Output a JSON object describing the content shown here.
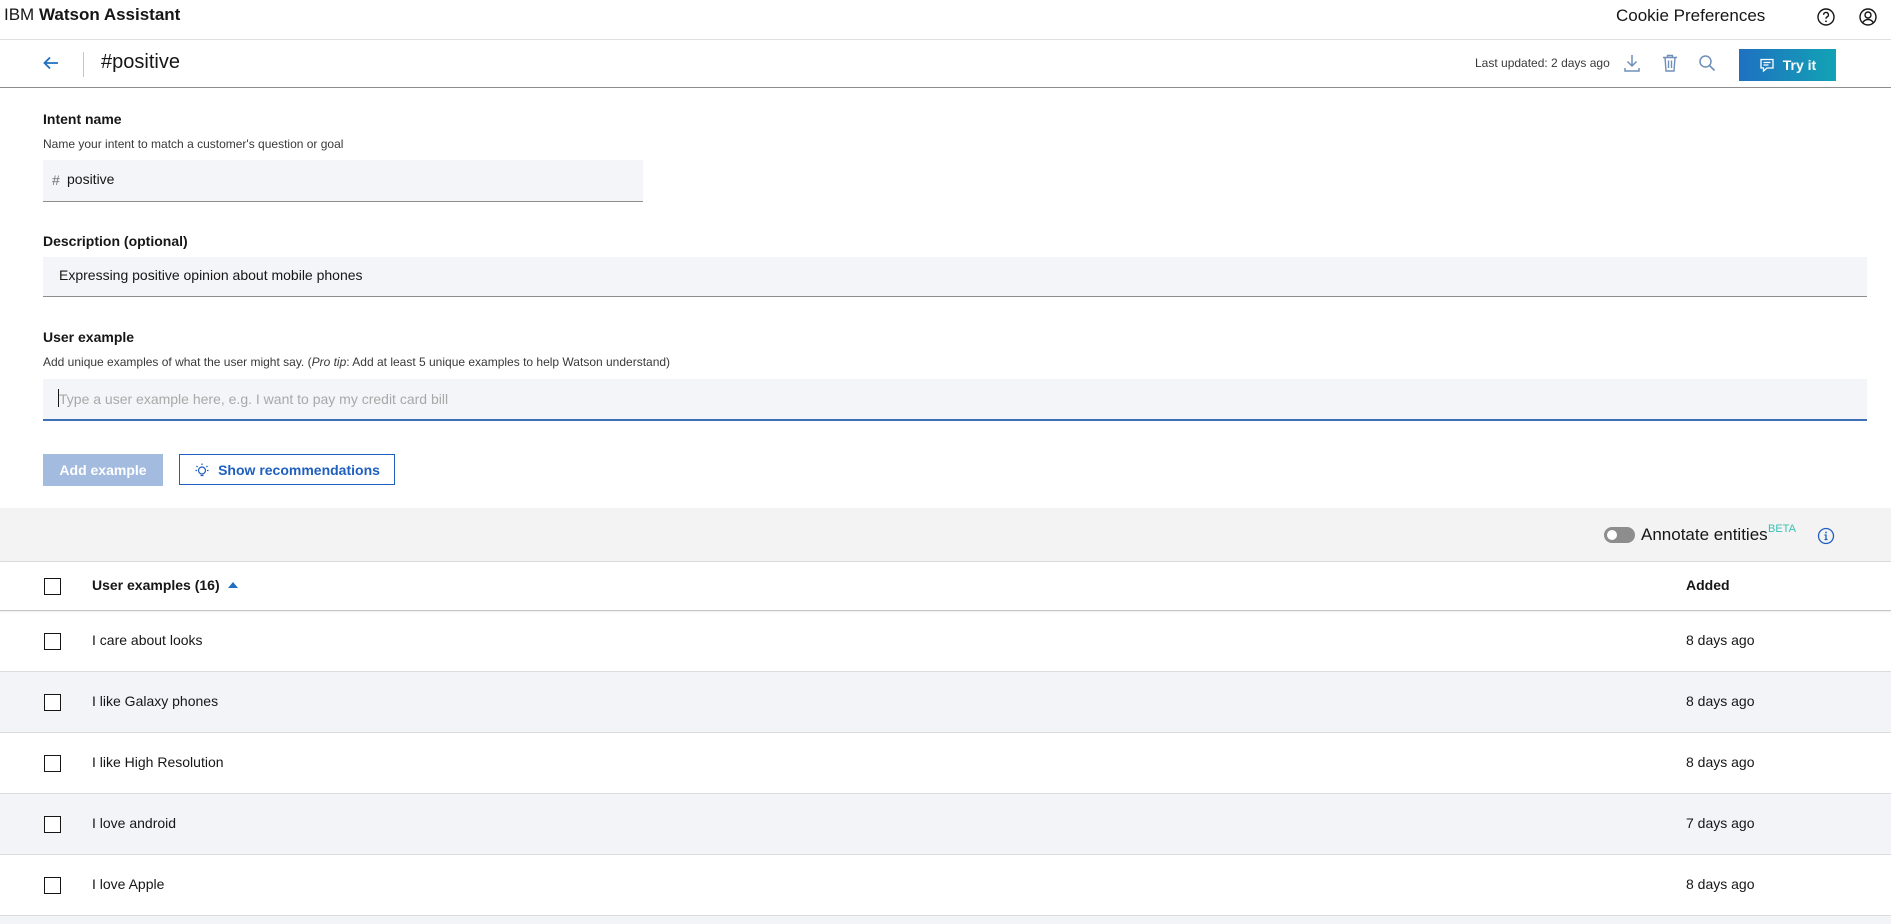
{
  "topbar": {
    "brand_prefix": "IBM",
    "brand_name": "Watson Assistant",
    "cookie_preferences": "Cookie Preferences"
  },
  "header": {
    "title": "#positive",
    "last_updated": "Last updated: 2 days ago",
    "try_label": "Try it"
  },
  "form": {
    "intent_name_label": "Intent name",
    "intent_name_helper": "Name your intent to match a customer's question or goal",
    "intent_hash": "#",
    "intent_name_value": "positive",
    "description_label": "Description (optional)",
    "description_value": "Expressing positive opinion about mobile phones",
    "user_example_label": "User example",
    "user_example_helper_prefix": "Add unique examples of what the user might say. (",
    "user_example_helper_protip": "Pro tip",
    "user_example_helper_suffix": ": Add at least 5 unique examples to help Watson understand)",
    "user_example_placeholder": "Type a user example here, e.g. I want to pay my credit card bill",
    "add_example_label": "Add example",
    "show_recommendations_label": "Show recommendations"
  },
  "annotate": {
    "label": "Annotate entities",
    "beta": "BETA",
    "enabled": false
  },
  "table": {
    "col_examples": "User examples (16)",
    "col_added": "Added",
    "rows": [
      {
        "example": "I care about looks",
        "added": "8 days ago"
      },
      {
        "example": "I like Galaxy phones",
        "added": "8 days ago"
      },
      {
        "example": "I like High Resolution",
        "added": "8 days ago"
      },
      {
        "example": "I love android",
        "added": "7 days ago"
      },
      {
        "example": "I love Apple",
        "added": "8 days ago"
      }
    ]
  },
  "colors": {
    "accent": "#1f70c1",
    "try_gradient_end": "#12a3b4",
    "beta": "#35c3b4"
  }
}
